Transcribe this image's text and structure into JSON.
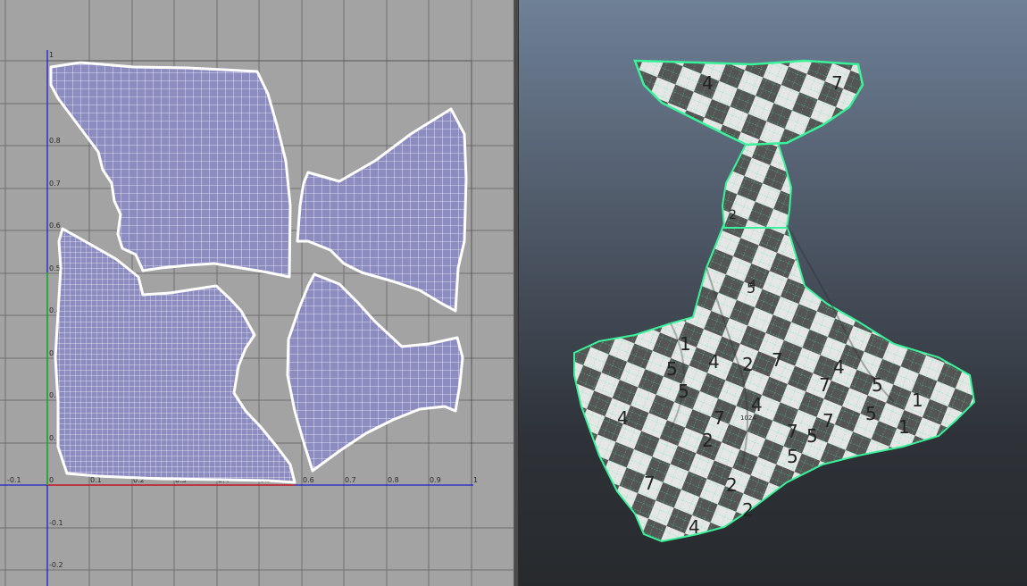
{
  "uv_editor": {
    "u_ticks": [
      "-0.1",
      "0",
      "0.1",
      "0.2",
      "0.3",
      "0.4",
      "0.5",
      "0.6",
      "0.7",
      "0.8",
      "0.9",
      "1"
    ],
    "v_ticks": [
      "1",
      "0.8",
      "0.7",
      "0.6",
      "0.5",
      "0.4",
      "0.3",
      "0.2",
      "0.1",
      "-0.1",
      "-0.2"
    ],
    "colors": {
      "background": "#a3a3a3",
      "shell_fill": "#8c8cc0",
      "shell_border": "#ffffff",
      "u_axis": "#cc2020",
      "v_axis": "#2020cc",
      "grid": "#6f6f6f"
    }
  },
  "viewport": {
    "checker_labels": [
      "4",
      "7",
      "2",
      "5",
      "1",
      "4",
      "5",
      "7",
      "2",
      "5",
      "4",
      "7",
      "5",
      "2",
      "4",
      "7",
      "5",
      "7",
      "1",
      "4",
      "2",
      "1",
      "5",
      "4",
      "7",
      "2",
      "5",
      "7",
      "4"
    ],
    "tiny_label": "1024",
    "colors": {
      "wireframe": "#3af29a",
      "checker_dark": "#555555",
      "checker_light": "#e6e6e6"
    }
  }
}
